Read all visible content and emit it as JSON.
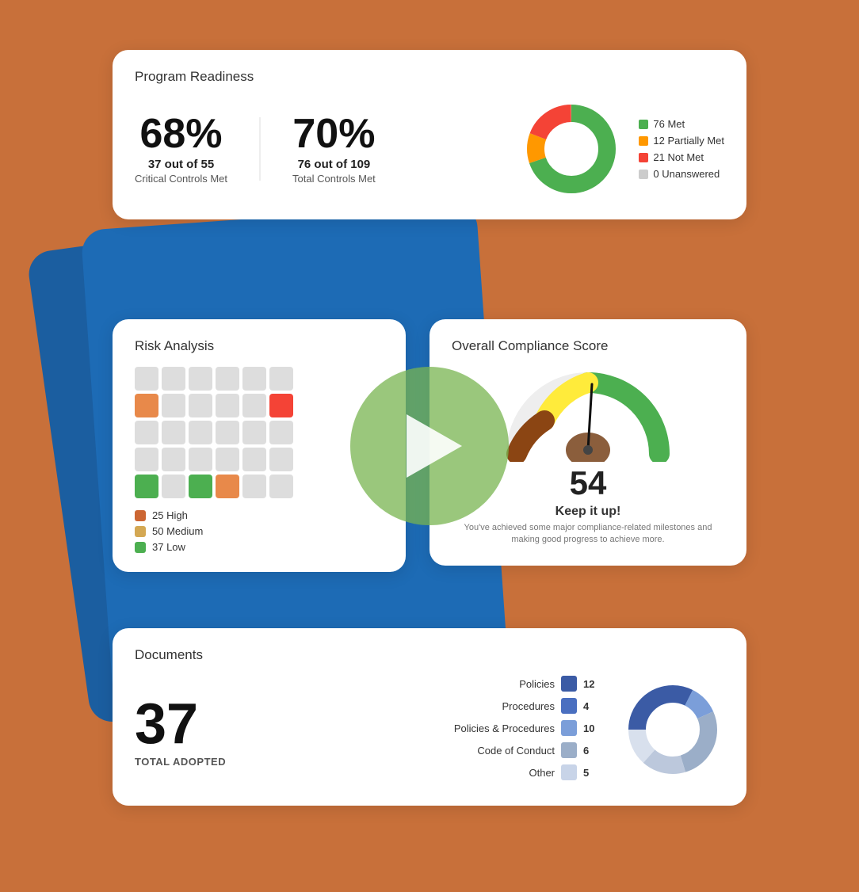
{
  "background_color": "#C8703A",
  "program_readiness": {
    "title": "Program Readiness",
    "stat1": {
      "percent": "68%",
      "detail": "37 out of 55",
      "label": "Critical Controls Met"
    },
    "stat2": {
      "percent": "70%",
      "detail": "76 out of 109",
      "label": "Total Controls Met"
    },
    "donut": {
      "met_value": 76,
      "partial_value": 12,
      "not_met_value": 21,
      "unanswered_value": 0,
      "total": 109
    },
    "legend": [
      {
        "label": "76 Met",
        "color": "#4CAF50"
      },
      {
        "label": "12 Partially Met",
        "color": "#FF9800"
      },
      {
        "label": "21 Not Met",
        "color": "#F44336"
      },
      {
        "label": "0 Unanswered",
        "color": "#CCCCCC"
      }
    ]
  },
  "risk_analysis": {
    "title": "Risk Analysis",
    "legend": [
      {
        "label": "25 High",
        "color": "#CC6633"
      },
      {
        "label": "50 Medium",
        "color": "#D4A853"
      },
      {
        "label": "37 Low",
        "color": "#4CAF50"
      }
    ]
  },
  "compliance": {
    "title": "Overall Compliance Score",
    "score": "54",
    "keep_it_up": "Keep it up!",
    "description": "You've achieved some major compliance-related milestones and making good progress to achieve more."
  },
  "documents": {
    "title": "Documents",
    "total": "37",
    "total_label": "TOTAL ADOPTED",
    "items": [
      {
        "name": "Policies",
        "count": "12",
        "color": "#3B5BA5"
      },
      {
        "name": "Procedures",
        "count": "4",
        "color": "#4A6FC0"
      },
      {
        "name": "Policies & Procedures",
        "count": "10",
        "color": "#7B9ED9"
      },
      {
        "name": "Code of Conduct",
        "count": "6",
        "color": "#9BAEC8"
      },
      {
        "name": "Other",
        "count": "5",
        "color": "#C8D4E8"
      }
    ]
  }
}
